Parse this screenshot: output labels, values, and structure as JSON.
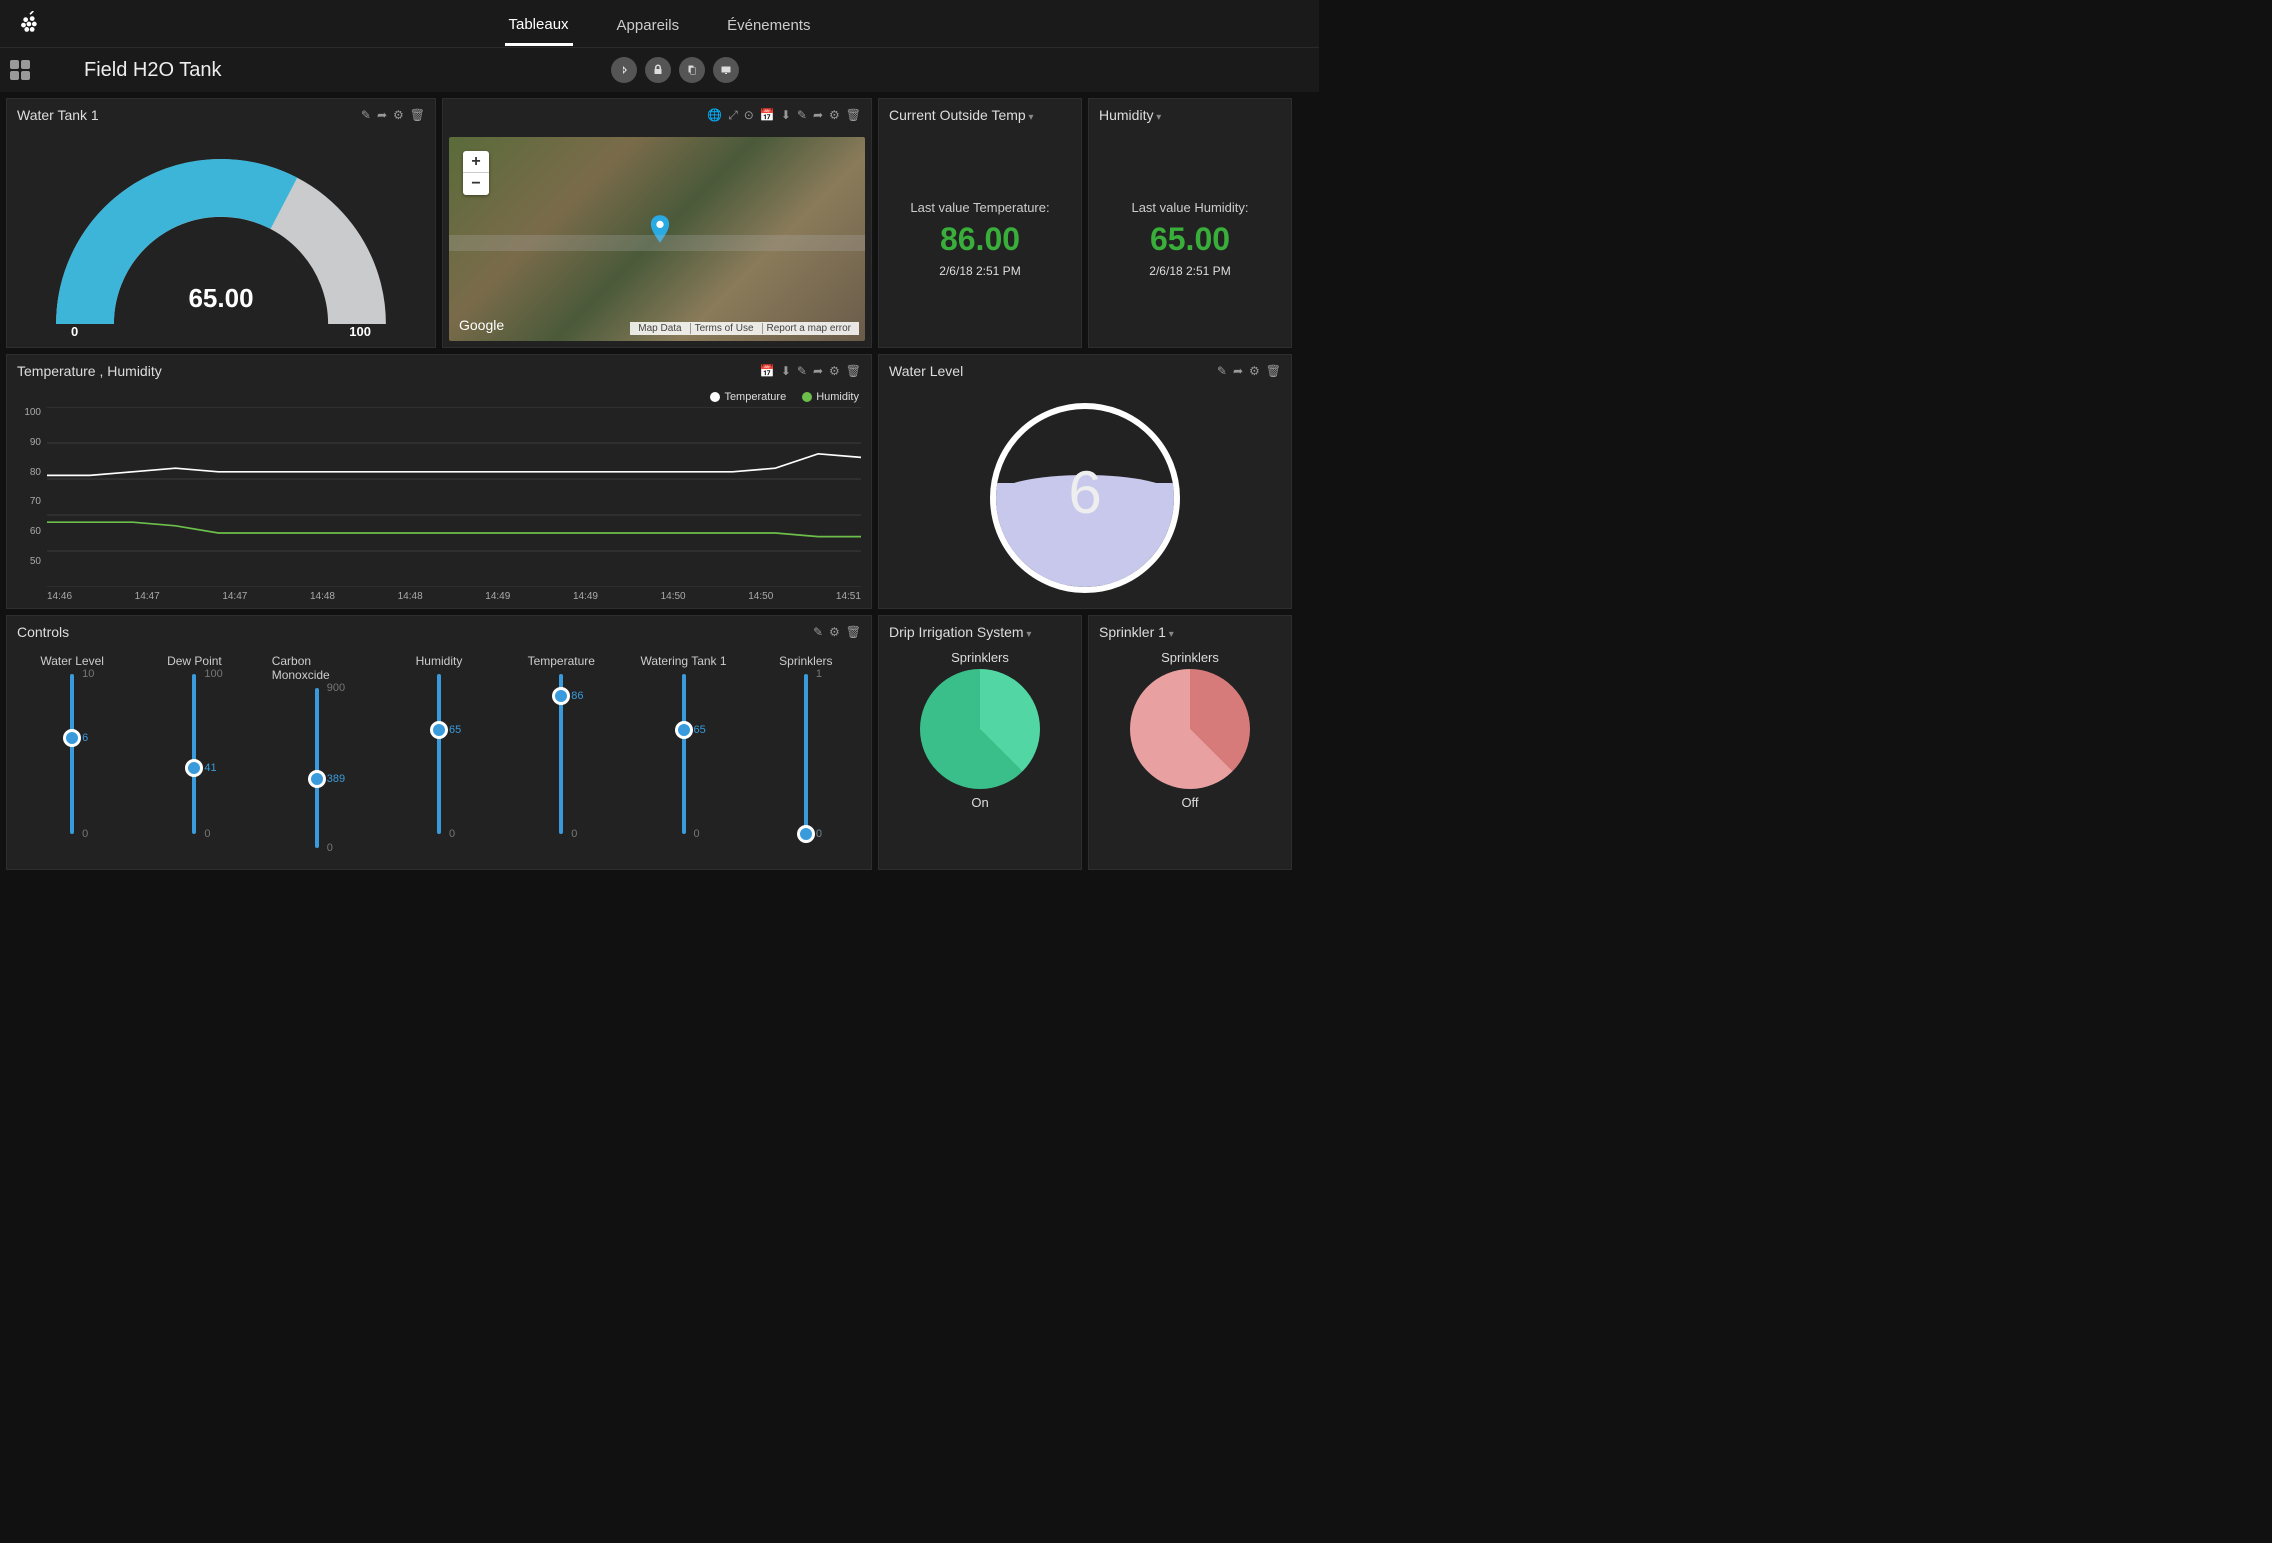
{
  "nav": {
    "items": [
      "Tableaux",
      "Appareils",
      "Événements"
    ],
    "active": 0
  },
  "page_title": "Field H2O Tank",
  "widgets": {
    "water_tank": {
      "title": "Water Tank 1",
      "value": "65.00",
      "min": "0",
      "max": "100",
      "pct": 65
    },
    "map": {
      "attribution": [
        "Map Data",
        "Terms of Use",
        "Report a map error"
      ],
      "logo": "Google"
    },
    "temp": {
      "title": "Current Outside Temp",
      "label": "Last value Temperature:",
      "value": "86.00",
      "time": "2/6/18 2:51 PM"
    },
    "humidity": {
      "title": "Humidity",
      "label": "Last value Humidity:",
      "value": "65.00",
      "time": "2/6/18 2:51 PM"
    },
    "chart": {
      "title": "Temperature , Humidity",
      "legend": [
        "Temperature",
        "Humidity"
      ]
    },
    "water_level": {
      "title": "Water Level",
      "value": "6"
    },
    "controls": {
      "title": "Controls",
      "sliders": [
        {
          "name": "Water Level",
          "max": "10",
          "val": "6",
          "min": "0",
          "pct": 60
        },
        {
          "name": "Dew Point",
          "max": "100",
          "val": "41",
          "min": "0",
          "pct": 41
        },
        {
          "name": "Carbon Monoxcide",
          "max": "900",
          "val": "389",
          "min": "0",
          "pct": 43
        },
        {
          "name": "Humidity",
          "max": "",
          "val": "65",
          "min": "0",
          "pct": 65
        },
        {
          "name": "Temperature",
          "max": "",
          "val": "86",
          "min": "0",
          "pct": 86
        },
        {
          "name": "Watering Tank 1",
          "max": "",
          "val": "65",
          "min": "0",
          "pct": 65
        },
        {
          "name": "Sprinklers",
          "max": "1",
          "val": "0",
          "min": "0",
          "pct": 0
        }
      ]
    },
    "drip": {
      "title": "Drip Irrigation System",
      "label": "Sprinklers",
      "state": "On"
    },
    "sprinkler": {
      "title": "Sprinkler 1",
      "label": "Sprinklers",
      "state": "Off"
    }
  },
  "chart_data": {
    "type": "line",
    "title": "Temperature , Humidity",
    "xlabel": "",
    "ylabel": "",
    "ylim": [
      50,
      100
    ],
    "x_ticks": [
      "14:46",
      "14:47",
      "14:47",
      "14:48",
      "14:48",
      "14:49",
      "14:49",
      "14:50",
      "14:50",
      "14:51"
    ],
    "series": [
      {
        "name": "Temperature",
        "color": "#ffffff",
        "values": [
          81,
          81,
          82,
          83,
          82,
          82,
          82,
          82,
          82,
          82,
          82,
          82,
          82,
          82,
          82,
          82,
          82,
          83,
          87,
          86
        ]
      },
      {
        "name": "Humidity",
        "color": "#6dbf4b",
        "values": [
          68,
          68,
          68,
          67,
          65,
          65,
          65,
          65,
          65,
          65,
          65,
          65,
          65,
          65,
          65,
          65,
          65,
          65,
          64,
          64
        ]
      }
    ],
    "y_ticks": [
      100,
      90,
      80,
      70,
      60,
      50
    ]
  }
}
